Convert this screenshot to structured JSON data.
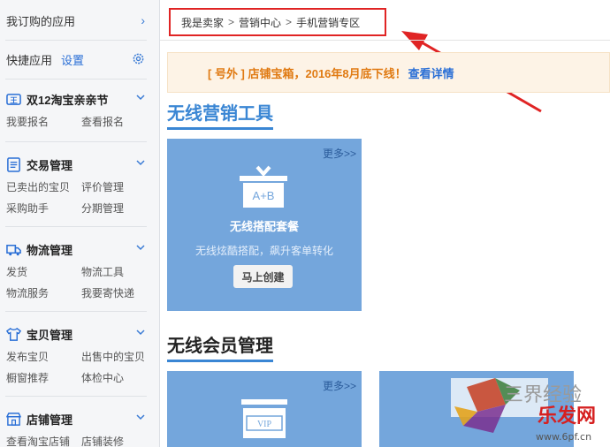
{
  "sidebar": {
    "subscribed_apps": "我订购的应用",
    "quick_apps": "快捷应用",
    "settings_link": "设置",
    "groups": [
      {
        "title": "双12淘宝亲亲节",
        "items": [
          "我要报名",
          "查看报名"
        ]
      },
      {
        "title": "交易管理",
        "items": [
          "已卖出的宝贝",
          "评价管理",
          "采购助手",
          "分期管理"
        ]
      },
      {
        "title": "物流管理",
        "items": [
          "发货",
          "物流工具",
          "物流服务",
          "我要寄快递"
        ]
      },
      {
        "title": "宝贝管理",
        "items": [
          "发布宝贝",
          "出售中的宝贝",
          "橱窗推荐",
          "体检中心"
        ]
      },
      {
        "title": "店铺管理",
        "items": [
          "查看淘宝店铺",
          "店铺装修"
        ]
      }
    ]
  },
  "breadcrumb": [
    "我是卖家",
    "营销中心",
    "手机营销专区"
  ],
  "breadcrumb_separator": ">",
  "notice": {
    "text": "[ 号外 ] 店铺宝箱，2016年8月底下线！",
    "link": "查看详情"
  },
  "sections": {
    "wireless_marketing": "无线营销工具",
    "wireless_member": "无线会员管理"
  },
  "card1": {
    "more": "更多>>",
    "icon_text": "A+B",
    "title": "无线搭配套餐",
    "desc": "无线炫酷搭配，飙升客单转化",
    "button": "马上创建"
  },
  "card2": {
    "more": "更多>>",
    "icon_text": "VIP"
  },
  "watermark": {
    "text": "三界经验",
    "brand": "乐发网",
    "url": "www.6pf.cn"
  },
  "colors": {
    "accent": "#3a86d4",
    "card": "#74a6dc",
    "highlight_border": "#e02424",
    "notice_text": "#e07a12"
  }
}
